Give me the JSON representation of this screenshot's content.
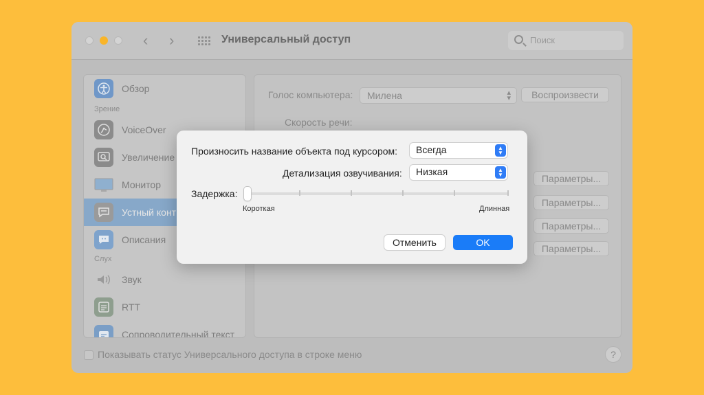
{
  "window": {
    "title": "Универсальный доступ",
    "search_placeholder": "Поиск",
    "back_glyph": "‹",
    "forward_glyph": "›"
  },
  "sidebar": {
    "items": [
      {
        "label": "Обзор",
        "icon": "accessibility-icon",
        "selected": false
      },
      {
        "label": "VoiceOver",
        "icon": "voiceover-icon",
        "selected": false
      },
      {
        "label": "Увеличение",
        "icon": "zoom-icon",
        "selected": false
      },
      {
        "label": "Монитор",
        "icon": "display-icon",
        "selected": false
      },
      {
        "label": "Устный конт",
        "icon": "spoken-content-icon",
        "selected": true
      },
      {
        "label": "Описания",
        "icon": "descriptions-icon",
        "selected": false
      },
      {
        "label": "Звук",
        "icon": "audio-icon",
        "selected": false
      },
      {
        "label": "RTT",
        "icon": "rtt-icon",
        "selected": false
      },
      {
        "label": "Сопроводительный текст",
        "icon": "captions-icon",
        "selected": false
      }
    ],
    "sections": {
      "vision": "Зрение",
      "hearing": "Слух"
    }
  },
  "content": {
    "voice_label": "Голос компьютера:",
    "voice_value": "Милена",
    "play_button": "Воспроизвести",
    "rate_label": "Скорость речи:",
    "options_button": "Параметры..."
  },
  "footer": {
    "status_checkbox_label": "Показывать статус Универсального доступа в строке меню",
    "status_checked": false,
    "help": "?"
  },
  "dialog": {
    "announce_label": "Произносить название объекта под курсором:",
    "announce_value": "Всегда",
    "verbosity_label": "Детализация озвучивания:",
    "verbosity_value": "Низкая",
    "delay_label": "Задержка:",
    "delay_min_label": "Короткая",
    "delay_max_label": "Длинная",
    "delay_value": 0,
    "cancel_button": "Отменить",
    "ok_button": "OK"
  },
  "colors": {
    "background": "#FDBE3C",
    "accent": "#1A7CF8",
    "selected_row": "#87A8C9"
  }
}
